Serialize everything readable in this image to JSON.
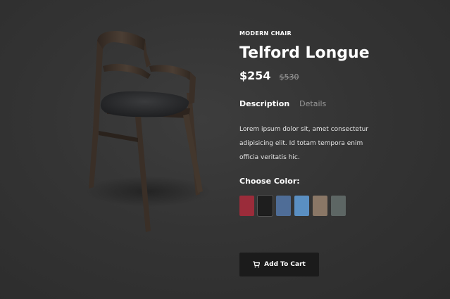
{
  "product": {
    "category": "MODERN CHAIR",
    "title": "Telford Longue",
    "price": "$254",
    "old_price": "$530",
    "image_name": "chair-product-image"
  },
  "tabs": [
    {
      "label": "Description",
      "active": true
    },
    {
      "label": "Details",
      "active": false
    }
  ],
  "description": "Lorem ipsum dolor sit, amet consectetur adipisicing elit. Id totam tempora enim officia veritatis hic.",
  "color_picker": {
    "label": "Choose Color:",
    "swatches": [
      {
        "name": "red",
        "color": "#9b2c3a",
        "selected": false
      },
      {
        "name": "black",
        "color": "#1e1e1e",
        "selected": true
      },
      {
        "name": "denim",
        "color": "#4f6d97",
        "selected": false
      },
      {
        "name": "light-blue",
        "color": "#5a8fc2",
        "selected": false
      },
      {
        "name": "tan",
        "color": "#8a7766",
        "selected": false
      },
      {
        "name": "grey-green",
        "color": "#5d6664",
        "selected": false
      }
    ]
  },
  "cart_button": {
    "label": "Add To Cart",
    "icon": "cart-icon"
  },
  "colors": {
    "background": "#333333",
    "button_bg": "#1b1b1b",
    "muted_text": "#9a9a9a"
  }
}
